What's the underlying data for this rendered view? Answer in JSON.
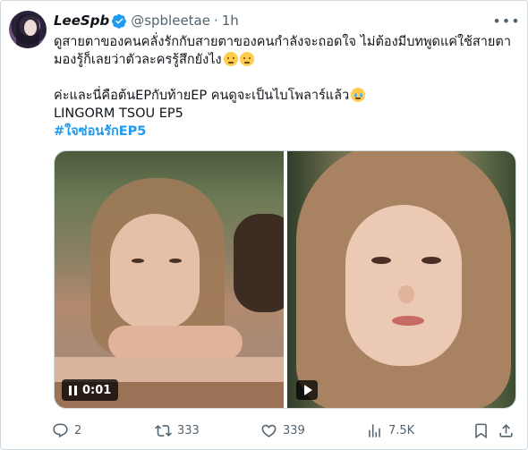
{
  "author": {
    "display_name": "LeeSpb",
    "handle": "@spbleetae",
    "separator": "·",
    "time": "1h"
  },
  "tweet": {
    "line1": "ดูสายตาของคนคลั่งรักกับสายตาของคนกำลังจะถอดใจ ไม่ต้องมีบทพูดแค่ใช้สายตา",
    "line2": "มองรู้ก็เลยว่าตัวละครรู้สึกยังไง",
    "line3": "ค่ะและนี่คือต้นEPกับท้ายEP คนดูจะเป็นไบโพลาร์แล้ว",
    "line4": "LINGORM TSOU EP5",
    "hashtag": "#ใจซ่อนรักEP5"
  },
  "media": {
    "video1_time": "0:01"
  },
  "actions": {
    "replies": "2",
    "reposts": "333",
    "likes": "339",
    "views": "7.5K"
  },
  "icons": {
    "verified": "verified-badge-icon",
    "more": "more-icon",
    "reply": "reply-icon",
    "repost": "repost-icon",
    "like": "heart-icon",
    "views": "views-icon",
    "bookmark": "bookmark-icon",
    "share": "share-icon"
  },
  "colors": {
    "accent": "#1d9bf0",
    "muted": "#536471",
    "text": "#0f1419"
  }
}
